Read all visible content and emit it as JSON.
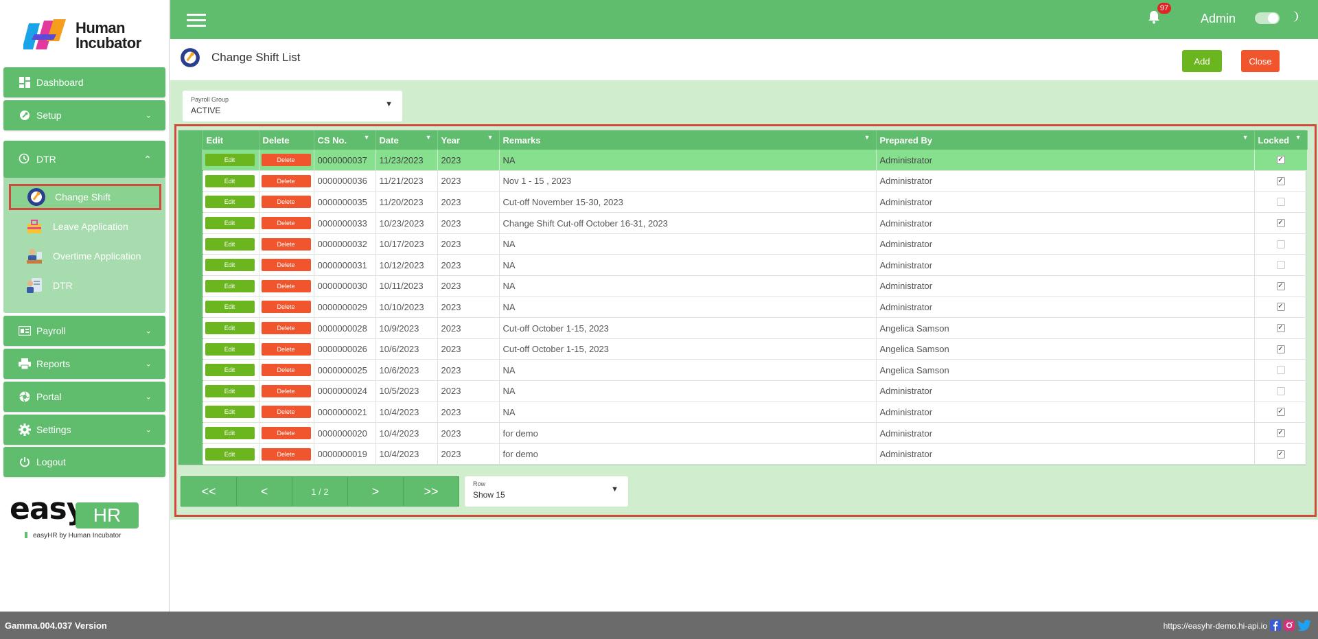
{
  "brand": {
    "name_line1": "Human",
    "name_line2": "Incubator",
    "easyhr_word": "easy",
    "easyhr_hr": "HR",
    "easyhr_tagline": "easyHR by Human Incubator"
  },
  "sidebar": {
    "items": [
      {
        "label": "Dashboard",
        "icon": "dashboard-icon"
      },
      {
        "label": "Setup",
        "icon": "wrench-icon"
      },
      {
        "label": "DTR",
        "icon": "clock-icon"
      },
      {
        "label": "Payroll",
        "icon": "payroll-icon"
      },
      {
        "label": "Reports",
        "icon": "printer-icon"
      },
      {
        "label": "Portal",
        "icon": "aperture-icon"
      },
      {
        "label": "Settings",
        "icon": "gear-icon"
      },
      {
        "label": "Logout",
        "icon": "power-icon"
      }
    ],
    "dtr_subitems": [
      {
        "label": "Change Shift",
        "icon": "change-shift-icon",
        "active": true
      },
      {
        "label": "Leave Application",
        "icon": "luggage-icon"
      },
      {
        "label": "Overtime Application",
        "icon": "overtime-icon"
      },
      {
        "label": "DTR",
        "icon": "id-card-icon"
      }
    ]
  },
  "topbar": {
    "notification_count": "97",
    "user": "Admin"
  },
  "page": {
    "title": "Change Shift List",
    "add_label": "Add",
    "close_label": "Close"
  },
  "filter": {
    "label": "Payroll Group",
    "value": "ACTIVE"
  },
  "table": {
    "columns": [
      "Edit",
      "Delete",
      "CS No.",
      "Date",
      "Year",
      "Remarks",
      "Prepared By",
      "Locked"
    ],
    "edit_label": "Edit",
    "delete_label": "Delete",
    "rows": [
      {
        "cs_no": "0000000037",
        "date": "11/23/2023",
        "year": "2023",
        "remarks": "NA",
        "prepared_by": "Administrator",
        "locked": true
      },
      {
        "cs_no": "0000000036",
        "date": "11/21/2023",
        "year": "2023",
        "remarks": "Nov 1 - 15 , 2023",
        "prepared_by": "Administrator",
        "locked": true
      },
      {
        "cs_no": "0000000035",
        "date": "11/20/2023",
        "year": "2023",
        "remarks": "Cut-off November 15-30, 2023",
        "prepared_by": "Administrator",
        "locked": false
      },
      {
        "cs_no": "0000000033",
        "date": "10/23/2023",
        "year": "2023",
        "remarks": "Change Shift Cut-off October 16-31, 2023",
        "prepared_by": "Administrator",
        "locked": true
      },
      {
        "cs_no": "0000000032",
        "date": "10/17/2023",
        "year": "2023",
        "remarks": "NA",
        "prepared_by": "Administrator",
        "locked": false
      },
      {
        "cs_no": "0000000031",
        "date": "10/12/2023",
        "year": "2023",
        "remarks": "NA",
        "prepared_by": "Administrator",
        "locked": false
      },
      {
        "cs_no": "0000000030",
        "date": "10/11/2023",
        "year": "2023",
        "remarks": "NA",
        "prepared_by": "Administrator",
        "locked": true
      },
      {
        "cs_no": "0000000029",
        "date": "10/10/2023",
        "year": "2023",
        "remarks": "NA",
        "prepared_by": "Administrator",
        "locked": true
      },
      {
        "cs_no": "0000000028",
        "date": "10/9/2023",
        "year": "2023",
        "remarks": "Cut-off October 1-15, 2023",
        "prepared_by": "Angelica Samson",
        "locked": true
      },
      {
        "cs_no": "0000000026",
        "date": "10/6/2023",
        "year": "2023",
        "remarks": "Cut-off October 1-15, 2023",
        "prepared_by": "Angelica Samson",
        "locked": true
      },
      {
        "cs_no": "0000000025",
        "date": "10/6/2023",
        "year": "2023",
        "remarks": "NA",
        "prepared_by": "Angelica Samson",
        "locked": false
      },
      {
        "cs_no": "0000000024",
        "date": "10/5/2023",
        "year": "2023",
        "remarks": "NA",
        "prepared_by": "Administrator",
        "locked": false
      },
      {
        "cs_no": "0000000021",
        "date": "10/4/2023",
        "year": "2023",
        "remarks": "NA",
        "prepared_by": "Administrator",
        "locked": true
      },
      {
        "cs_no": "0000000020",
        "date": "10/4/2023",
        "year": "2023",
        "remarks": "for demo",
        "prepared_by": "Administrator",
        "locked": true
      },
      {
        "cs_no": "0000000019",
        "date": "10/4/2023",
        "year": "2023",
        "remarks": "for demo",
        "prepared_by": "Administrator",
        "locked": true
      }
    ]
  },
  "pager": {
    "first": "<<",
    "prev": "<",
    "info": "1 / 2",
    "next": ">",
    "last": ">>"
  },
  "rows_select": {
    "label": "Row",
    "value": "Show 15"
  },
  "footer": {
    "version": "Gamma.004.037 Version",
    "url": "https://easyhr-demo.hi-api.io"
  },
  "colors": {
    "primary_green": "#5fbd6d",
    "content_bg": "#d0eecd",
    "edit_green": "#6bb61e",
    "delete_orange": "#f0552e",
    "highlight_frame": "#d04a3c"
  }
}
